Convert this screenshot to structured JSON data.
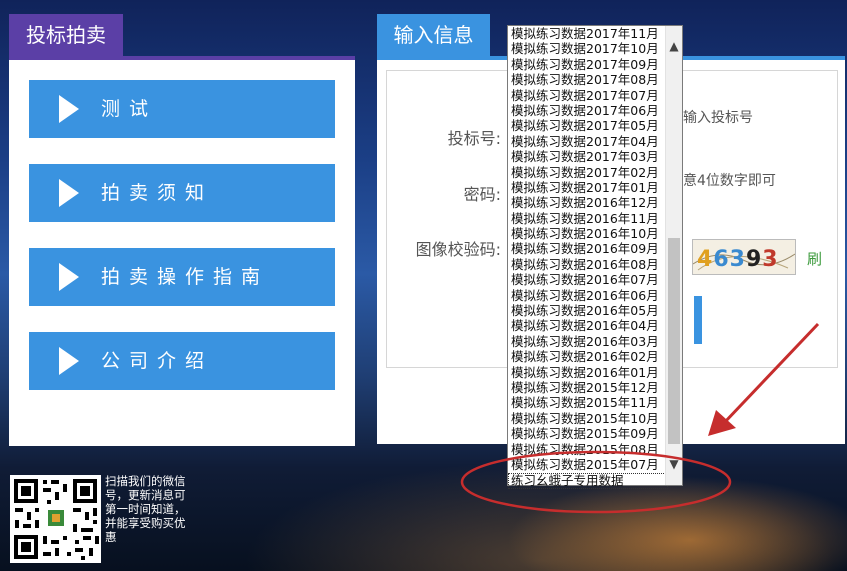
{
  "left": {
    "tab_title": "投标拍卖",
    "menu": [
      {
        "label": "测试"
      },
      {
        "label": "拍卖须知"
      },
      {
        "label": "拍卖操作指南"
      },
      {
        "label": "公司介绍"
      }
    ]
  },
  "qr": {
    "text": "扫描我们的微信号，更新消息可第一时间知道，并能享受购买优惠"
  },
  "right": {
    "tab_title": "输入信息",
    "bid_label": "投标号:",
    "bid_hint": "输入投标号",
    "pwd_label": "密码:",
    "pwd_hint": "意4位数字即可",
    "captcha_label": "图像校验码:",
    "captcha_text": "46393",
    "refresh_label": "刷"
  },
  "dropdown": {
    "options": [
      "模拟练习数据2017年11月",
      "模拟练习数据2017年10月",
      "模拟练习数据2017年09月",
      "模拟练习数据2017年08月",
      "模拟练习数据2017年07月",
      "模拟练习数据2017年06月",
      "模拟练习数据2017年05月",
      "模拟练习数据2017年04月",
      "模拟练习数据2017年03月",
      "模拟练习数据2017年02月",
      "模拟练习数据2017年01月",
      "模拟练习数据2016年12月",
      "模拟练习数据2016年11月",
      "模拟练习数据2016年10月",
      "模拟练习数据2016年09月",
      "模拟练习数据2016年08月",
      "模拟练习数据2016年07月",
      "模拟练习数据2016年06月",
      "模拟练习数据2016年05月",
      "模拟练习数据2016年04月",
      "模拟练习数据2016年03月",
      "模拟练习数据2016年02月",
      "模拟练习数据2016年01月",
      "模拟练习数据2015年12月",
      "模拟练习数据2015年11月",
      "模拟练习数据2015年10月",
      "模拟练习数据2015年09月",
      "模拟练习数据2015年08月",
      "模拟练习数据2015年07月"
    ],
    "last_option": "练习幺蛾子专用数据",
    "scroll_up_icon": "▲",
    "scroll_down_icon": "▼"
  },
  "colors": {
    "purple": "#5b3fa6",
    "blue": "#3a93e0",
    "annotation_red": "#c62d2d"
  }
}
